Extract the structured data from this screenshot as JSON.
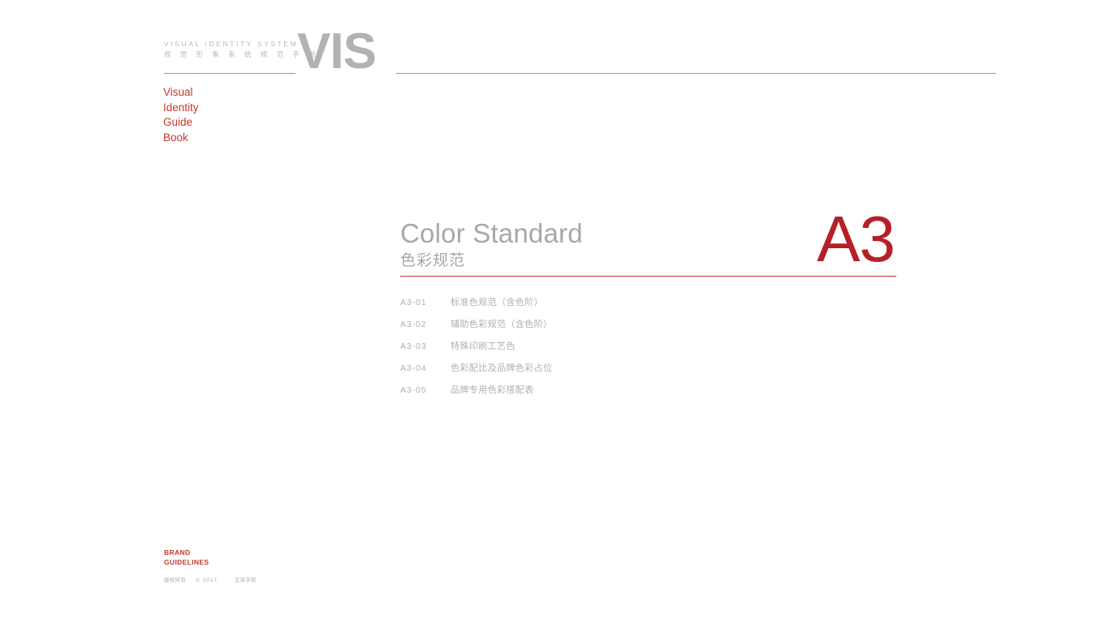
{
  "masthead": {
    "system_en": "VISUAL  IDENTITY  SYSTEM",
    "system_cn": "视 觉 形 象 系 统 规 范 手 册",
    "logo": "VIS",
    "guide_lines": "Visual\nIdentity\nGuide\nBook"
  },
  "title": {
    "en": "Color Standard",
    "cn": "色彩规范",
    "section_mark": "A3"
  },
  "contents": [
    {
      "code": "A3-01",
      "label": "标准色规范（含色阶）"
    },
    {
      "code": "A3-02",
      "label": "辅助色彩规范（含色阶）"
    },
    {
      "code": "A3-03",
      "label": "特殊印刷工艺色"
    },
    {
      "code": "A3-04",
      "label": "色彩配比及品牌色彩占位"
    },
    {
      "code": "A3-05",
      "label": "品牌专用色彩搭配表"
    }
  ],
  "footer": {
    "brand_line1": "BRAND",
    "brand_line2": "GUIDELINES",
    "copyright_cn": "版权所有",
    "copyright_year": "© 2017",
    "copyright_org": "正泽学校"
  },
  "colors": {
    "brand_red": "#c0392b",
    "mark_red": "#b52028",
    "rule_red": "#c3352f",
    "rule_light_red": "#cf7f79",
    "logo_gray": "#b2b2b2",
    "title_gray": "#a8a8a8",
    "muted_gray": "#b0b0b0",
    "page_bg": "#ffffff"
  }
}
